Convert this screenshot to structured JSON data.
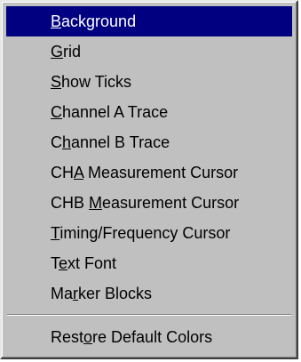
{
  "menu": {
    "items": [
      {
        "pre": "",
        "key": "B",
        "post": "ackground",
        "selected": true
      },
      {
        "pre": "",
        "key": "G",
        "post": "rid"
      },
      {
        "pre": "",
        "key": "S",
        "post": "how Ticks"
      },
      {
        "pre": "",
        "key": "C",
        "post": "hannel A Trace"
      },
      {
        "pre": "C",
        "key": "h",
        "post": "annel B Trace"
      },
      {
        "pre": "CH",
        "key": "A",
        "post": " Measurement Cursor"
      },
      {
        "pre": "CHB ",
        "key": "M",
        "post": "easurement Cursor"
      },
      {
        "pre": "",
        "key": "T",
        "post": "iming/Frequency Cursor"
      },
      {
        "pre": "T",
        "key": "e",
        "post": "xt Font"
      },
      {
        "pre": "Ma",
        "key": "r",
        "post": "ker Blocks"
      }
    ],
    "footer_item": {
      "pre": "Rest",
      "key": "o",
      "post": "re Default Colors"
    }
  }
}
